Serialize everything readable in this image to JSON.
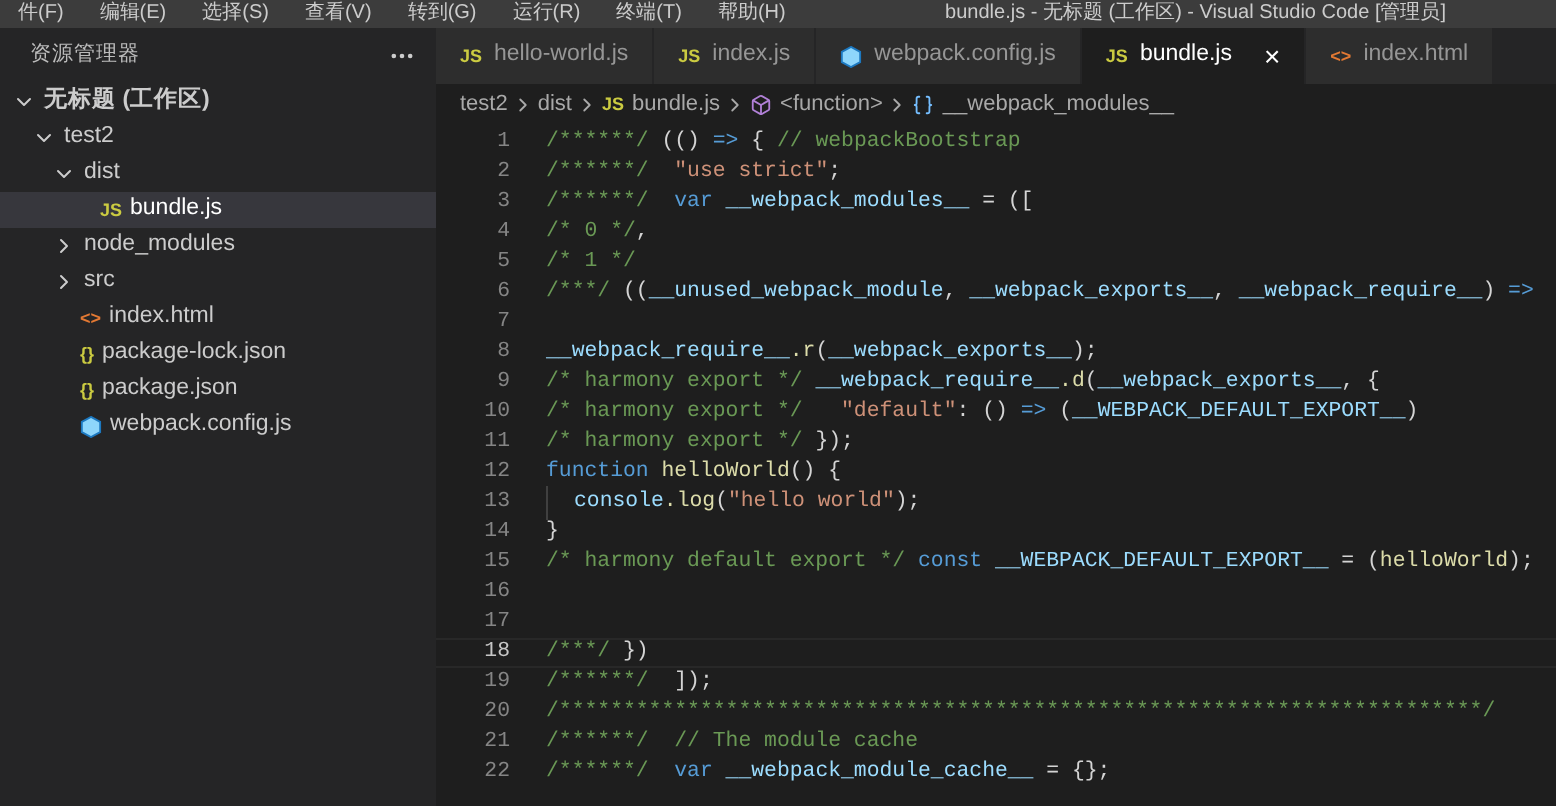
{
  "menu_bar": {
    "items": [
      "件(F)",
      "编辑(E)",
      "选择(S)",
      "查看(V)",
      "转到(G)",
      "运行(R)",
      "终端(T)",
      "帮助(H)"
    ],
    "title": "bundle.js - 无标题 (工作区) - Visual Studio Code [管理员]"
  },
  "sidebar": {
    "title": "资源管理器",
    "tree": [
      {
        "label": "无标题 (工作区)",
        "kind": "root",
        "expanded": true,
        "selected": false,
        "children": [
          {
            "label": "test2",
            "kind": "folder",
            "expanded": true,
            "selected": false,
            "children": [
              {
                "label": "dist",
                "kind": "folder",
                "expanded": true,
                "selected": false,
                "children": [
                  {
                    "label": "bundle.js",
                    "kind": "js",
                    "icon_text": "JS",
                    "selected": true
                  }
                ]
              },
              {
                "label": "node_modules",
                "kind": "folder",
                "expanded": false,
                "selected": false
              },
              {
                "label": "src",
                "kind": "folder",
                "expanded": false,
                "selected": false
              },
              {
                "label": "index.html",
                "kind": "html",
                "icon_text": "<>",
                "selected": false
              },
              {
                "label": "package-lock.json",
                "kind": "json",
                "icon_text": "{}",
                "selected": false
              },
              {
                "label": "package.json",
                "kind": "json",
                "icon_text": "{}",
                "selected": false
              },
              {
                "label": "webpack.config.js",
                "kind": "webpack",
                "selected": false
              }
            ]
          }
        ]
      }
    ]
  },
  "tabs": [
    {
      "label": "hello-world.js",
      "kind": "js",
      "icon_text": "JS",
      "selected": false
    },
    {
      "label": "index.js",
      "kind": "js",
      "icon_text": "JS",
      "selected": false
    },
    {
      "label": "webpack.config.js",
      "kind": "webpack",
      "selected": false
    },
    {
      "label": "bundle.js",
      "kind": "js",
      "icon_text": "JS",
      "selected": true,
      "close": "×"
    },
    {
      "label": "index.html",
      "kind": "html",
      "icon_text": "<>",
      "selected": false
    }
  ],
  "breadcrumb": [
    {
      "label": "test2",
      "kind": "text"
    },
    {
      "label": "dist",
      "kind": "text"
    },
    {
      "label": "bundle.js",
      "kind": "js",
      "icon_text": "JS"
    },
    {
      "label": "<function>",
      "kind": "function"
    },
    {
      "label": "__webpack_modules__",
      "kind": "variable"
    }
  ],
  "editor": {
    "lines": [
      {
        "number": "1",
        "current": false,
        "tokens": [
          {
            "text": "/******/ ",
            "kind": "comment"
          },
          {
            "text": "(() ",
            "kind": "plain"
          },
          {
            "text": "=> ",
            "kind": "keyword"
          },
          {
            "text": "{ ",
            "kind": "plain"
          },
          {
            "text": "// webpackBootstrap",
            "kind": "comment"
          }
        ]
      },
      {
        "number": "2",
        "current": false,
        "tokens": [
          {
            "text": "/******/  ",
            "kind": "comment"
          },
          {
            "text": "\"use strict\"",
            "kind": "string"
          },
          {
            "text": ";",
            "kind": "plain"
          }
        ]
      },
      {
        "number": "3",
        "current": false,
        "tokens": [
          {
            "text": "/******/  ",
            "kind": "comment"
          },
          {
            "text": "var ",
            "kind": "keyword"
          },
          {
            "text": "__webpack_modules__",
            "kind": "var"
          },
          {
            "text": " = ([",
            "kind": "plain"
          }
        ]
      },
      {
        "number": "4",
        "current": false,
        "tokens": [
          {
            "text": "/* 0 */",
            "kind": "comment"
          },
          {
            "text": ",",
            "kind": "plain"
          }
        ]
      },
      {
        "number": "5",
        "current": false,
        "tokens": [
          {
            "text": "/* 1 */",
            "kind": "comment"
          }
        ]
      },
      {
        "number": "6",
        "current": false,
        "tokens": [
          {
            "text": "/***/ ",
            "kind": "comment"
          },
          {
            "text": "((",
            "kind": "plain"
          },
          {
            "text": "__unused_webpack_module",
            "kind": "var"
          },
          {
            "text": ", ",
            "kind": "plain"
          },
          {
            "text": "__webpack_exports__",
            "kind": "var"
          },
          {
            "text": ", ",
            "kind": "plain"
          },
          {
            "text": "__webpack_require__",
            "kind": "var"
          },
          {
            "text": ") ",
            "kind": "plain"
          },
          {
            "text": "=>",
            "kind": "keyword"
          }
        ]
      },
      {
        "number": "7",
        "current": false
      },
      {
        "number": "8",
        "current": false,
        "tokens": [
          {
            "text": "__webpack_require__",
            "kind": "var"
          },
          {
            "text": ".r",
            "kind": "func"
          },
          {
            "text": "(",
            "kind": "plain"
          },
          {
            "text": "__webpack_exports__",
            "kind": "var"
          },
          {
            "text": ");",
            "kind": "plain"
          }
        ]
      },
      {
        "number": "9",
        "current": false,
        "tokens": [
          {
            "text": "/* harmony export */ ",
            "kind": "comment"
          },
          {
            "text": "__webpack_require__",
            "kind": "var"
          },
          {
            "text": ".d",
            "kind": "func"
          },
          {
            "text": "(",
            "kind": "plain"
          },
          {
            "text": "__webpack_exports__",
            "kind": "var"
          },
          {
            "text": ", {",
            "kind": "plain"
          }
        ]
      },
      {
        "number": "10",
        "current": false,
        "tokens": [
          {
            "text": "/* harmony export */   ",
            "kind": "comment"
          },
          {
            "text": "\"default\"",
            "kind": "string"
          },
          {
            "text": ": () ",
            "kind": "plain"
          },
          {
            "text": "=> ",
            "kind": "keyword"
          },
          {
            "text": "(",
            "kind": "plain"
          },
          {
            "text": "__WEBPACK_DEFAULT_EXPORT__",
            "kind": "var"
          },
          {
            "text": ")",
            "kind": "plain"
          }
        ]
      },
      {
        "number": "11",
        "current": false,
        "tokens": [
          {
            "text": "/* harmony export */ ",
            "kind": "comment"
          },
          {
            "text": "});",
            "kind": "plain"
          }
        ]
      },
      {
        "number": "12",
        "current": false,
        "tokens": [
          {
            "text": "function ",
            "kind": "keyword"
          },
          {
            "text": "helloWorld",
            "kind": "func"
          },
          {
            "text": "() {",
            "kind": "plain"
          }
        ]
      },
      {
        "number": "13",
        "current": false,
        "indented": true,
        "tokens": [
          {
            "text": "console",
            "kind": "var"
          },
          {
            "text": ".log",
            "kind": "func"
          },
          {
            "text": "(",
            "kind": "plain"
          },
          {
            "text": "\"hello world\"",
            "kind": "string"
          },
          {
            "text": ");",
            "kind": "plain"
          }
        ]
      },
      {
        "number": "14",
        "current": false,
        "tokens": [
          {
            "text": "}",
            "kind": "plain"
          }
        ]
      },
      {
        "number": "15",
        "current": false,
        "tokens": [
          {
            "text": "/* harmony default export */ ",
            "kind": "comment"
          },
          {
            "text": "const ",
            "kind": "keyword"
          },
          {
            "text": "__WEBPACK_DEFAULT_EXPORT__",
            "kind": "var"
          },
          {
            "text": " = (",
            "kind": "plain"
          },
          {
            "text": "helloWorld",
            "kind": "func"
          },
          {
            "text": ");",
            "kind": "plain"
          }
        ]
      },
      {
        "number": "16",
        "current": false
      },
      {
        "number": "17",
        "current": false
      },
      {
        "number": "18",
        "current": true,
        "tokens": [
          {
            "text": "/***/ ",
            "kind": "comment"
          },
          {
            "text": "})",
            "kind": "plain"
          }
        ]
      },
      {
        "number": "19",
        "current": false,
        "tokens": [
          {
            "text": "/******/  ",
            "kind": "comment"
          },
          {
            "text": "]);",
            "kind": "plain"
          }
        ]
      },
      {
        "number": "20",
        "current": false,
        "tokens": [
          {
            "text": "/************************************************************************/",
            "kind": "comment"
          }
        ]
      },
      {
        "number": "21",
        "current": false,
        "tokens": [
          {
            "text": "/******/  // The module cache",
            "kind": "comment"
          }
        ]
      },
      {
        "number": "22",
        "current": false,
        "tokens": [
          {
            "text": "/******/  ",
            "kind": "comment"
          },
          {
            "text": "var ",
            "kind": "keyword"
          },
          {
            "text": "__webpack_module_cache__",
            "kind": "var"
          },
          {
            "text": " = {};",
            "kind": "plain"
          }
        ]
      }
    ]
  }
}
